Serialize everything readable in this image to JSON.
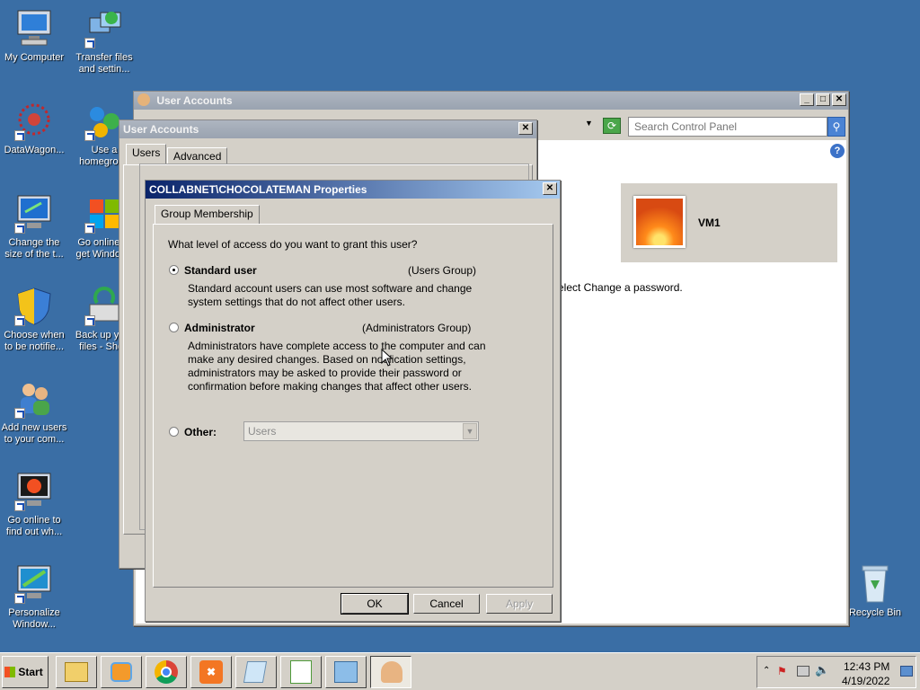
{
  "desktop_icons": [
    {
      "label": "My Computer",
      "icon": "my-computer-icon"
    },
    {
      "label": "Transfer files and settin...",
      "icon": "transfer-files-icon"
    },
    {
      "label": "DataWagon...",
      "icon": "datawagon-icon"
    },
    {
      "label": "Use a homegroup",
      "icon": "homegroup-icon"
    },
    {
      "label": "Change the size of the t...",
      "icon": "change-text-size-icon"
    },
    {
      "label": "Go online to get Windows",
      "icon": "windows-logo-icon"
    },
    {
      "label": "Choose when to be notifie...",
      "icon": "uac-shield-icon"
    },
    {
      "label": "Back up your files - Short",
      "icon": "backup-icon"
    },
    {
      "label": "Add new users to your com...",
      "icon": "users-icon"
    },
    {
      "label": "Go online to find out wh...",
      "icon": "windows-online-icon"
    },
    {
      "label": "Personalize Window...",
      "icon": "personalize-icon"
    },
    {
      "label": "Recycle Bin",
      "icon": "recycle-bin-icon"
    }
  ],
  "cp_window": {
    "title": "User Accounts",
    "search_placeholder": "Search Control Panel",
    "user_name": "VM1",
    "partial_text": "elect Change a password."
  },
  "ua_dialog": {
    "title": "User Accounts",
    "tabs": [
      "Users",
      "Advanced"
    ]
  },
  "props_dialog": {
    "title": "COLLABNET\\CHOCOLATEMAN Properties",
    "tab": "Group Membership",
    "question": "What level of access do you want to grant this user?",
    "options": [
      {
        "label": "Standard user",
        "group": "(Users Group)",
        "selected": true,
        "desc": "Standard account users can use most software and change system settings that do not affect other users."
      },
      {
        "label": "Administrator",
        "group": "(Administrators Group)",
        "selected": false,
        "desc": "Administrators have complete access to the computer and can make any desired changes. Based on notification settings, administrators may be asked to provide their password or confirmation before making changes that affect other users."
      },
      {
        "label": "Other:",
        "selected": false
      }
    ],
    "other_select_value": "Users",
    "buttons": {
      "ok": "OK",
      "cancel": "Cancel",
      "apply": "Apply"
    }
  },
  "taskbar": {
    "start_label": "Start",
    "time": "12:43 PM",
    "date": "4/19/2022"
  }
}
